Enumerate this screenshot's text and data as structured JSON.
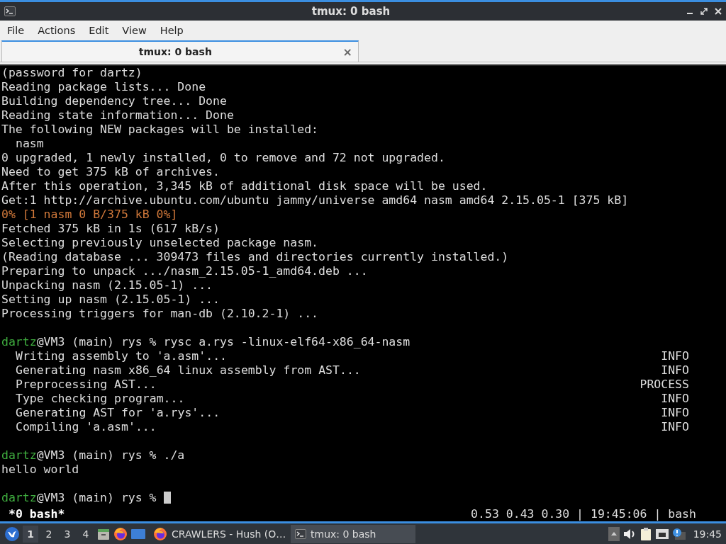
{
  "window": {
    "title": "tmux: 0 bash"
  },
  "menu": [
    "File",
    "Actions",
    "Edit",
    "View",
    "Help"
  ],
  "tabs": [
    {
      "label": "tmux: 0 bash",
      "close": "×",
      "selected": true
    }
  ],
  "terminal": {
    "lines": [
      {
        "kind": "plain",
        "text": "(password for dartz)"
      },
      {
        "kind": "plain",
        "text": "Reading package lists... Done"
      },
      {
        "kind": "plain",
        "text": "Building dependency tree... Done"
      },
      {
        "kind": "plain",
        "text": "Reading state information... Done"
      },
      {
        "kind": "plain",
        "text": "The following NEW packages will be installed:"
      },
      {
        "kind": "indented",
        "text": "nasm"
      },
      {
        "kind": "plain",
        "text": "0 upgraded, 1 newly installed, 0 to remove and 72 not upgraded."
      },
      {
        "kind": "plain",
        "text": "Need to get 375 kB of archives."
      },
      {
        "kind": "plain",
        "text": "After this operation, 3,345 kB of additional disk space will be used."
      },
      {
        "kind": "plain",
        "text": "Get:1 http://archive.ubuntu.com/ubuntu jammy/universe amd64 nasm amd64 2.15.05-1 [375 kB]"
      },
      {
        "kind": "progress",
        "text": "0% [1 nasm 0 B/375 kB 0%]"
      },
      {
        "kind": "plain",
        "text": "Fetched 375 kB in 1s (617 kB/s)"
      },
      {
        "kind": "plain",
        "text": "Selecting previously unselected package nasm."
      },
      {
        "kind": "plain",
        "text": "(Reading database ... 309473 files and directories currently installed.)"
      },
      {
        "kind": "plain",
        "text": "Preparing to unpack .../nasm_2.15.05-1_amd64.deb ..."
      },
      {
        "kind": "plain",
        "text": "Unpacking nasm (2.15.05-1) ..."
      },
      {
        "kind": "plain",
        "text": "Setting up nasm (2.15.05-1) ..."
      },
      {
        "kind": "plain",
        "text": "Processing triggers for man-db (2.10.2-1) ..."
      },
      {
        "kind": "blank"
      },
      {
        "kind": "prompt",
        "user": "dartz",
        "text": "@VM3 (main) rys % rysc a.rys -linux-elf64-x86_64-nasm",
        "cursor": false
      },
      {
        "kind": "log",
        "text": "Writing assembly to 'a.asm'...",
        "tag": "INFO"
      },
      {
        "kind": "log",
        "text": "Generating nasm x86_64 linux assembly from AST...",
        "tag": "INFO"
      },
      {
        "kind": "log",
        "text": "Preprocessing AST...",
        "tag": "PROCESS"
      },
      {
        "kind": "log",
        "text": "Type checking program...",
        "tag": "INFO"
      },
      {
        "kind": "log",
        "text": "Generating AST for 'a.rys'...",
        "tag": "INFO"
      },
      {
        "kind": "log",
        "text": "Compiling 'a.asm'...",
        "tag": "INFO"
      },
      {
        "kind": "blank"
      },
      {
        "kind": "prompt",
        "user": "dartz",
        "text": "@VM3 (main) rys % ./a",
        "cursor": false
      },
      {
        "kind": "plain",
        "text": "hello world"
      },
      {
        "kind": "blank"
      },
      {
        "kind": "prompt",
        "user": "dartz",
        "text": "@VM3 (main) rys %",
        "cursor": true
      }
    ],
    "status_left": "*0 bash*",
    "status_right": "0.53 0.43 0.30 | 19:45:06 | bash"
  },
  "taskbar": {
    "workspaces": [
      {
        "label": "1",
        "selected": true
      },
      {
        "label": "2",
        "selected": false
      },
      {
        "label": "3",
        "selected": false
      },
      {
        "label": "4",
        "selected": false
      }
    ],
    "launchers": [
      {
        "kind": "files"
      },
      {
        "kind": "browser"
      },
      {
        "kind": "desktop"
      }
    ],
    "windows": [
      {
        "kind": "browser",
        "label": "CRAWLERS - Hush (O…",
        "selected": false
      },
      {
        "kind": "terminal",
        "label": "tmux: 0 bash",
        "selected": true
      }
    ],
    "clock": "19:45"
  }
}
